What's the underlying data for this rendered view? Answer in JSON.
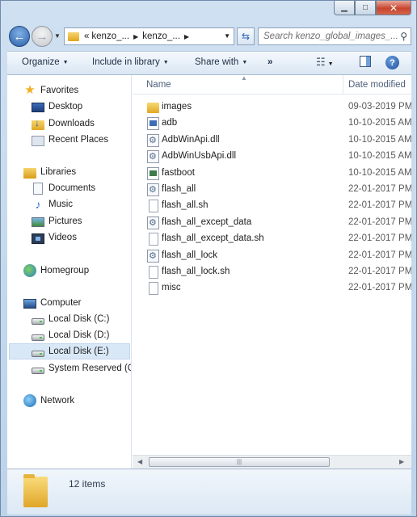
{
  "window": {
    "caption": {
      "minimize": "▁",
      "maximize": "□",
      "close": "✕"
    }
  },
  "navbar": {
    "address_prefix": "«",
    "crumbs": [
      "kenzo_...",
      "kenzo_..."
    ],
    "search_placeholder": "Search kenzo_global_images_..."
  },
  "commandbar": {
    "organize": "Organize",
    "include_in_library": "Include in library",
    "share_with": "Share with",
    "more": "»",
    "help": "?"
  },
  "navpane": {
    "favorites": "Favorites",
    "desktop": "Desktop",
    "downloads": "Downloads",
    "recent_places": "Recent Places",
    "libraries": "Libraries",
    "documents": "Documents",
    "music": "Music",
    "pictures": "Pictures",
    "videos": "Videos",
    "homegroup": "Homegroup",
    "computer": "Computer",
    "local_disk_c": "Local Disk (C:)",
    "local_disk_d": "Local Disk (D:)",
    "local_disk_e": "Local Disk (E:)",
    "system_reserved": "System Reserved (G:",
    "network": "Network",
    "selected": "local_disk_e"
  },
  "filelist": {
    "columns": {
      "name": "Name",
      "date": "Date modified"
    },
    "rows": [
      {
        "name": "images",
        "date": "09-03-2019 PM",
        "icon": "folder-icon"
      },
      {
        "name": "adb",
        "date": "10-10-2015 AM",
        "icon": "application-icon"
      },
      {
        "name": "AdbWinApi.dll",
        "date": "10-10-2015 AM",
        "icon": "dll-icon"
      },
      {
        "name": "AdbWinUsbApi.dll",
        "date": "10-10-2015 AM",
        "icon": "dll-icon"
      },
      {
        "name": "fastboot",
        "date": "10-10-2015 AM",
        "icon": "application-icon"
      },
      {
        "name": "flash_all",
        "date": "22-01-2017 PM",
        "icon": "batch-file-icon"
      },
      {
        "name": "flash_all.sh",
        "date": "22-01-2017 PM",
        "icon": "document-icon"
      },
      {
        "name": "flash_all_except_data",
        "date": "22-01-2017 PM",
        "icon": "batch-file-icon"
      },
      {
        "name": "flash_all_except_data.sh",
        "date": "22-01-2017 PM",
        "icon": "document-icon"
      },
      {
        "name": "flash_all_lock",
        "date": "22-01-2017 PM",
        "icon": "batch-file-icon"
      },
      {
        "name": "flash_all_lock.sh",
        "date": "22-01-2017 PM",
        "icon": "document-icon"
      },
      {
        "name": "misc",
        "date": "22-01-2017 PM",
        "icon": "document-icon"
      }
    ]
  },
  "details": {
    "item_count": "12 items"
  }
}
